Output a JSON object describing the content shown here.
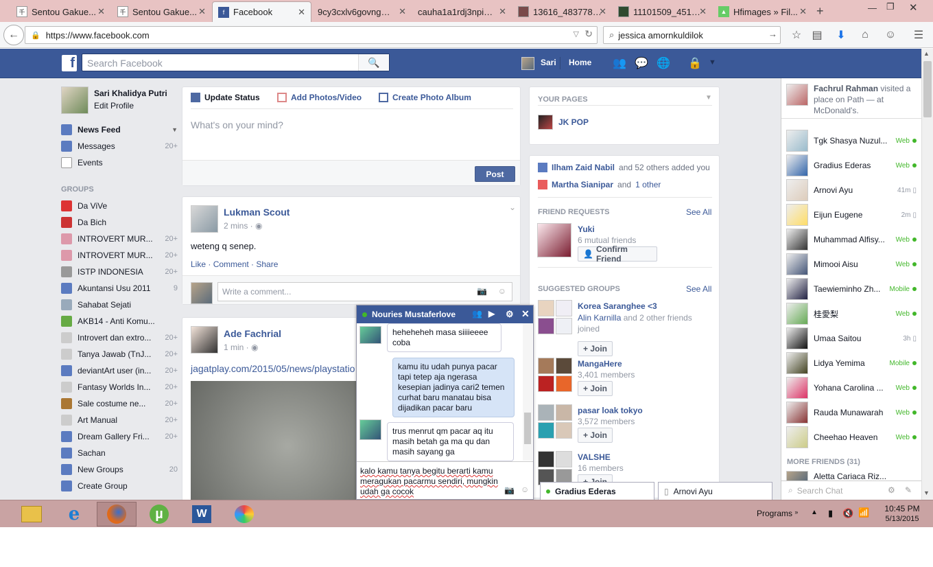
{
  "browser": {
    "tabs": [
      {
        "label": "Sentou Gakue...",
        "active": false
      },
      {
        "label": "Sentou Gakue...",
        "active": false
      },
      {
        "label": "Facebook",
        "active": true
      },
      {
        "label": "9cy3cxlv6govngb8j...",
        "active": false
      },
      {
        "label": "cauha1a1rdj3npi11...",
        "active": false
      },
      {
        "label": "13616_4837784...",
        "active": false
      },
      {
        "label": "11101509_4518...",
        "active": false
      },
      {
        "label": "Hfimages » Fil...",
        "active": false
      }
    ],
    "url": "https://www.facebook.com",
    "search_value": "jessica amornkuldilok"
  },
  "fb_header": {
    "search_placeholder": "Search Facebook",
    "user_name": "Sari",
    "home_label": "Home"
  },
  "left_nav": {
    "profile_name": "Sari Khalidya Putri",
    "edit_profile": "Edit Profile",
    "items": [
      {
        "label": "News Feed",
        "count": ""
      },
      {
        "label": "Messages",
        "count": "20+"
      },
      {
        "label": "Events",
        "count": ""
      }
    ],
    "groups_heading": "GROUPS",
    "groups": [
      {
        "label": "Da ViVe",
        "count": ""
      },
      {
        "label": "Da Bich",
        "count": ""
      },
      {
        "label": "INTROVERT MUR...",
        "count": "20+"
      },
      {
        "label": "INTROVERT MUR...",
        "count": "20+"
      },
      {
        "label": "ISTP INDONESIA",
        "count": "20+"
      },
      {
        "label": "Akuntansi Usu 2011",
        "count": "9"
      },
      {
        "label": "Sahabat Sejati",
        "count": ""
      },
      {
        "label": "AKB14 - Anti Komu...",
        "count": ""
      },
      {
        "label": "Introvert dan extro...",
        "count": "20+"
      },
      {
        "label": "Tanya Jawab (TnJ...",
        "count": "20+"
      },
      {
        "label": "deviantArt user (in...",
        "count": "20+"
      },
      {
        "label": "Fantasy Worlds In...",
        "count": "20+"
      },
      {
        "label": "Sale costume ne...",
        "count": "20+"
      },
      {
        "label": "Art Manual",
        "count": "20+"
      },
      {
        "label": "Dream Gallery Fri...",
        "count": "20+"
      },
      {
        "label": "Sachan",
        "count": ""
      },
      {
        "label": "New Groups",
        "count": "20"
      },
      {
        "label": "Create Group",
        "count": ""
      }
    ]
  },
  "composer": {
    "update_status": "Update Status",
    "add_photos": "Add Photos/Video",
    "create_album": "Create Photo Album",
    "placeholder": "What's on your mind?",
    "post_button": "Post"
  },
  "posts": [
    {
      "author": "Lukman Scout",
      "time": "2 mins",
      "text": "weteng q senep.",
      "like": "Like",
      "comment": "Comment",
      "share": "Share",
      "comment_placeholder": "Write a comment..."
    },
    {
      "author": "Ade Fachrial",
      "time": "1 min",
      "link": "jagatplay.com/2015/05/news/playstatio"
    }
  ],
  "right_col": {
    "your_pages": "YOUR PAGES",
    "page_name": "JK POP",
    "notif1_name": "Ilham Zaid Nabil",
    "notif1_rest": "and 52 others added you",
    "notif2_name": "Martha Sianipar",
    "notif2_and": "and",
    "notif2_rest": "1 other",
    "friend_requests": "FRIEND REQUESTS",
    "see_all": "See All",
    "request_name": "Yuki",
    "request_mutual": "6 mutual friends",
    "confirm": "Confirm Friend",
    "suggested_groups": "SUGGESTED GROUPS",
    "join": "Join",
    "groups": [
      {
        "name": "Korea Saranghee <3",
        "sub1": "Alin Karnilla",
        "sub2": "and 2 other friends joined"
      },
      {
        "name": "MangaHere",
        "sub1": "3,401 members",
        "sub2": ""
      },
      {
        "name": "pasar loak tokyo",
        "sub1": "3,572 members",
        "sub2": ""
      },
      {
        "name": "VALSHE",
        "sub1": "16 members",
        "sub2": ""
      }
    ]
  },
  "ticker": {
    "name": "Fachrul Rahman",
    "text": "visited a place on Path — at McDonald's."
  },
  "chat_list": [
    {
      "name": "Tgk Shasya Nuzul...",
      "status": "Web"
    },
    {
      "name": "Gradius Ederas",
      "status": "Web"
    },
    {
      "name": "Arnovi Ayu",
      "status": "41m"
    },
    {
      "name": "Eijun Eugene",
      "status": "2m"
    },
    {
      "name": "Muhammad Alfisy...",
      "status": "Web"
    },
    {
      "name": "Mimooi Aisu",
      "status": "Web"
    },
    {
      "name": "Taewieminho Zh...",
      "status": "Mobile"
    },
    {
      "name": "桂愛梨",
      "status": "Web"
    },
    {
      "name": "Umaa Saitou",
      "status": "3h"
    },
    {
      "name": "Lidya Yemima",
      "status": "Mobile"
    },
    {
      "name": "Yohana Carolina ...",
      "status": "Web"
    },
    {
      "name": "Rauda Munawarah",
      "status": "Web"
    },
    {
      "name": "Cheehao Heaven",
      "status": "Web"
    }
  ],
  "more_friends": "MORE FRIENDS (31)",
  "more_friends_partial": "Aletta Cariaca Riz...",
  "chat_search_placeholder": "Search Chat",
  "chat_window": {
    "title": "Nouries Mustaferlove",
    "messages": [
      {
        "from": "them",
        "text": "heheheheh masa siiiieeee coba"
      },
      {
        "from": "me",
        "text": "kamu itu udah punya pacar tapi tetep aja ngerasa kesepian jadinya cari2 temen curhat baru manatau bisa dijadikan pacar baru"
      },
      {
        "from": "them",
        "text": "trus menrut qm pacar aq itu masih betah ga ma qu dan masih sayang ga"
      }
    ],
    "input_value": "kalo kamu tanya begitu berarti kamu meragukan pacarmu sendiri, mungkin udah ga cocok"
  },
  "chat_tabs": [
    {
      "label": "Gradius Ederas"
    },
    {
      "label": "Arnovi Ayu"
    }
  ],
  "taskbar": {
    "programs": "Programs",
    "time": "10:45 PM",
    "date": "5/13/2015"
  },
  "colors": {
    "fb_blue": "#3b5998",
    "online_green": "#42b72a",
    "taskbar": "#c9a3a3"
  }
}
